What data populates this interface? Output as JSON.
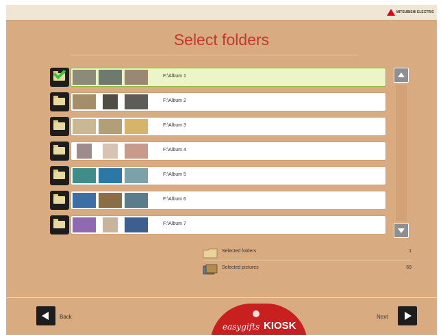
{
  "header": {
    "logo_text": "MITSUBISHI ELECTRIC",
    "logo_icon": "mitsubishi-logo-icon"
  },
  "page_title": "Select folders",
  "folders": [
    {
      "path": "F:\\Album 1",
      "selected": true,
      "thumbs": [
        "#8b8b78",
        "#6e7a6e",
        "#9b8872"
      ]
    },
    {
      "path": "F:\\Album 2",
      "selected": false,
      "thumbs": [
        "#a38e6a",
        "#504c46",
        "#5e5c58"
      ]
    },
    {
      "path": "F:\\Album 3",
      "selected": false,
      "thumbs": [
        "#c9b894",
        "#b29f78",
        "#d6b46a"
      ]
    },
    {
      "path": "F:\\Album 4",
      "selected": false,
      "thumbs": [
        "#9e8b8e",
        "#d7c2b4",
        "#c79a8c"
      ]
    },
    {
      "path": "F:\\Album 5",
      "selected": false,
      "thumbs": [
        "#3f8c8a",
        "#2b77a6",
        "#7ba2a8"
      ]
    },
    {
      "path": "F:\\Album 6",
      "selected": false,
      "thumbs": [
        "#3d6fa7",
        "#8b6e46",
        "#5b7c8b"
      ]
    },
    {
      "path": "F:\\Album 7",
      "selected": false,
      "thumbs": [
        "#8f6ab0",
        "#c8b49e",
        "#3c5f8f"
      ]
    }
  ],
  "summary": {
    "folders_label": "Selected folders",
    "folders_value": "1",
    "pictures_label": "Selected pictures",
    "pictures_value": "69"
  },
  "nav": {
    "back_label": "Back",
    "next_label": "Next"
  },
  "brand": {
    "part1": "easygifts",
    "part2": "KIOSK"
  },
  "colors": {
    "background": "#d9ab80",
    "title": "#c0392b",
    "selected_row": "#ecf5c6",
    "check": "#3cc43a"
  }
}
